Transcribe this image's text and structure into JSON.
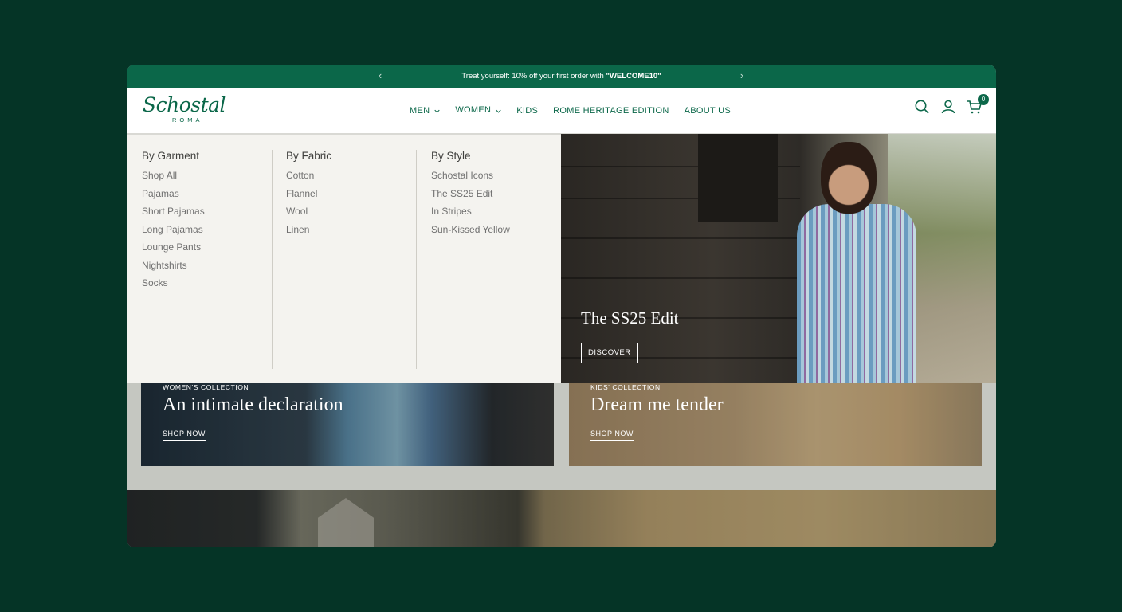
{
  "announcement": {
    "prefix": "Treat yourself: 10% off your first order with ",
    "code": "\"WELCOME10\"",
    "prev_icon": "chevron-left-icon",
    "next_icon": "chevron-right-icon"
  },
  "brand": {
    "name": "Schostal",
    "sub": "ROMA",
    "color": "#0b6749"
  },
  "nav": {
    "men": "MEN",
    "women": "WOMEN",
    "kids": "KIDS",
    "rome": "ROME HERITAGE EDITION",
    "about": "ABOUT US"
  },
  "header_icons": {
    "search": "search-icon",
    "account": "user-icon",
    "cart": "bag-icon",
    "cart_count": "0"
  },
  "mega_menu": {
    "garment": {
      "heading": "By Garment",
      "items": [
        "Shop All",
        "Pajamas",
        "Short Pajamas",
        "Long Pajamas",
        "Lounge Pants",
        "Nightshirts",
        "Socks"
      ]
    },
    "fabric": {
      "heading": "By Fabric",
      "items": [
        "Cotton",
        "Flannel",
        "Wool",
        "Linen"
      ]
    },
    "style": {
      "heading": "By Style",
      "items": [
        "Schostal Icons",
        "The SS25 Edit",
        "In Stripes",
        "Sun-Kissed Yellow"
      ]
    }
  },
  "feature": {
    "title": "The SS25 Edit",
    "button": "DISCOVER"
  },
  "cards": {
    "women": {
      "kicker": "WOMEN'S COLLECTION",
      "title": "An intimate declaration",
      "cta": "SHOP NOW"
    },
    "kids": {
      "kicker": "KIDS' COLLECTION",
      "title": "Dream me tender",
      "cta": "SHOP NOW"
    }
  }
}
